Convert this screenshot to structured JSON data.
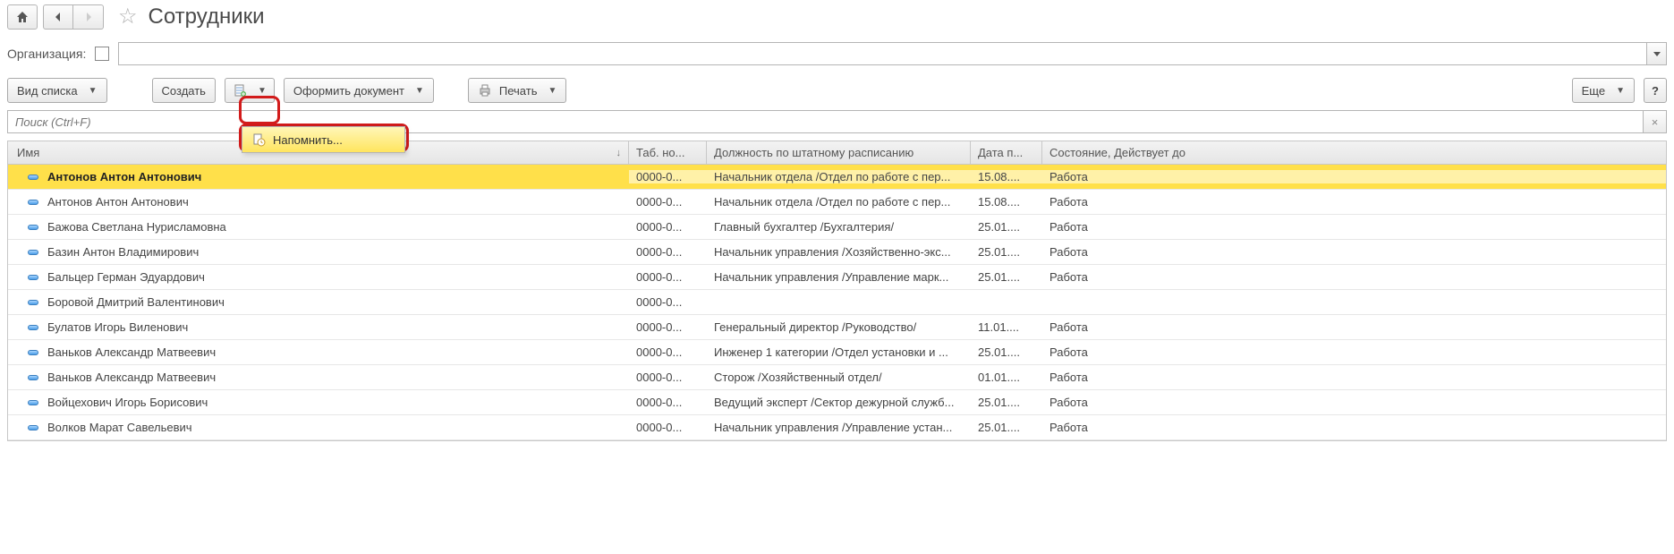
{
  "header": {
    "title": "Сотрудники"
  },
  "filter": {
    "org_label": "Организация:"
  },
  "toolbar": {
    "view_list": "Вид списка",
    "create": "Создать",
    "make_doc": "Оформить документ",
    "print": "Печать",
    "more": "Еще",
    "help": "?"
  },
  "dropdown": {
    "remind": "Напомнить..."
  },
  "search": {
    "placeholder": "Поиск (Ctrl+F)"
  },
  "columns": {
    "name": "Имя",
    "tab_no": "Таб. но...",
    "position": "Должность по штатному расписанию",
    "date": "Дата п...",
    "state": "Состояние, Действует до"
  },
  "rows": [
    {
      "name": "Антонов Антон Антонович",
      "tab": "0000-0...",
      "pos": "Начальник отдела /Отдел по работе с пер...",
      "date": "15.08....",
      "state": "Работа",
      "selected": true
    },
    {
      "name": "Антонов Антон Антонович",
      "tab": "0000-0...",
      "pos": "Начальник отдела /Отдел по работе с пер...",
      "date": "15.08....",
      "state": "Работа"
    },
    {
      "name": "Бажова Светлана Нурисламовна",
      "tab": "0000-0...",
      "pos": "Главный бухгалтер /Бухгалтерия/",
      "date": "25.01....",
      "state": "Работа"
    },
    {
      "name": "Базин Антон Владимирович",
      "tab": "0000-0...",
      "pos": "Начальник управления /Хозяйственно-экс...",
      "date": "25.01....",
      "state": "Работа"
    },
    {
      "name": "Бальцер Герман Эдуардович",
      "tab": "0000-0...",
      "pos": "Начальник управления /Управление марк...",
      "date": "25.01....",
      "state": "Работа"
    },
    {
      "name": "Боровой Дмитрий Валентинович",
      "tab": "0000-0...",
      "pos": "",
      "date": "",
      "state": ""
    },
    {
      "name": "Булатов Игорь Виленович",
      "tab": "0000-0...",
      "pos": "Генеральный директор /Руководство/",
      "date": "11.01....",
      "state": "Работа"
    },
    {
      "name": "Ваньков Александр Матвеевич",
      "tab": "0000-0...",
      "pos": "Инженер 1 категории /Отдел установки и ...",
      "date": "25.01....",
      "state": "Работа"
    },
    {
      "name": "Ваньков Александр Матвеевич",
      "tab": "0000-0...",
      "pos": "Сторож /Хозяйственный отдел/",
      "date": "01.01....",
      "state": "Работа"
    },
    {
      "name": "Войцехович Игорь Борисович",
      "tab": "0000-0...",
      "pos": "Ведущий эксперт /Сектор дежурной служб...",
      "date": "25.01....",
      "state": "Работа"
    },
    {
      "name": "Волков Марат Савельевич",
      "tab": "0000-0...",
      "pos": "Начальник управления /Управление устан...",
      "date": "25.01....",
      "state": "Работа"
    }
  ]
}
